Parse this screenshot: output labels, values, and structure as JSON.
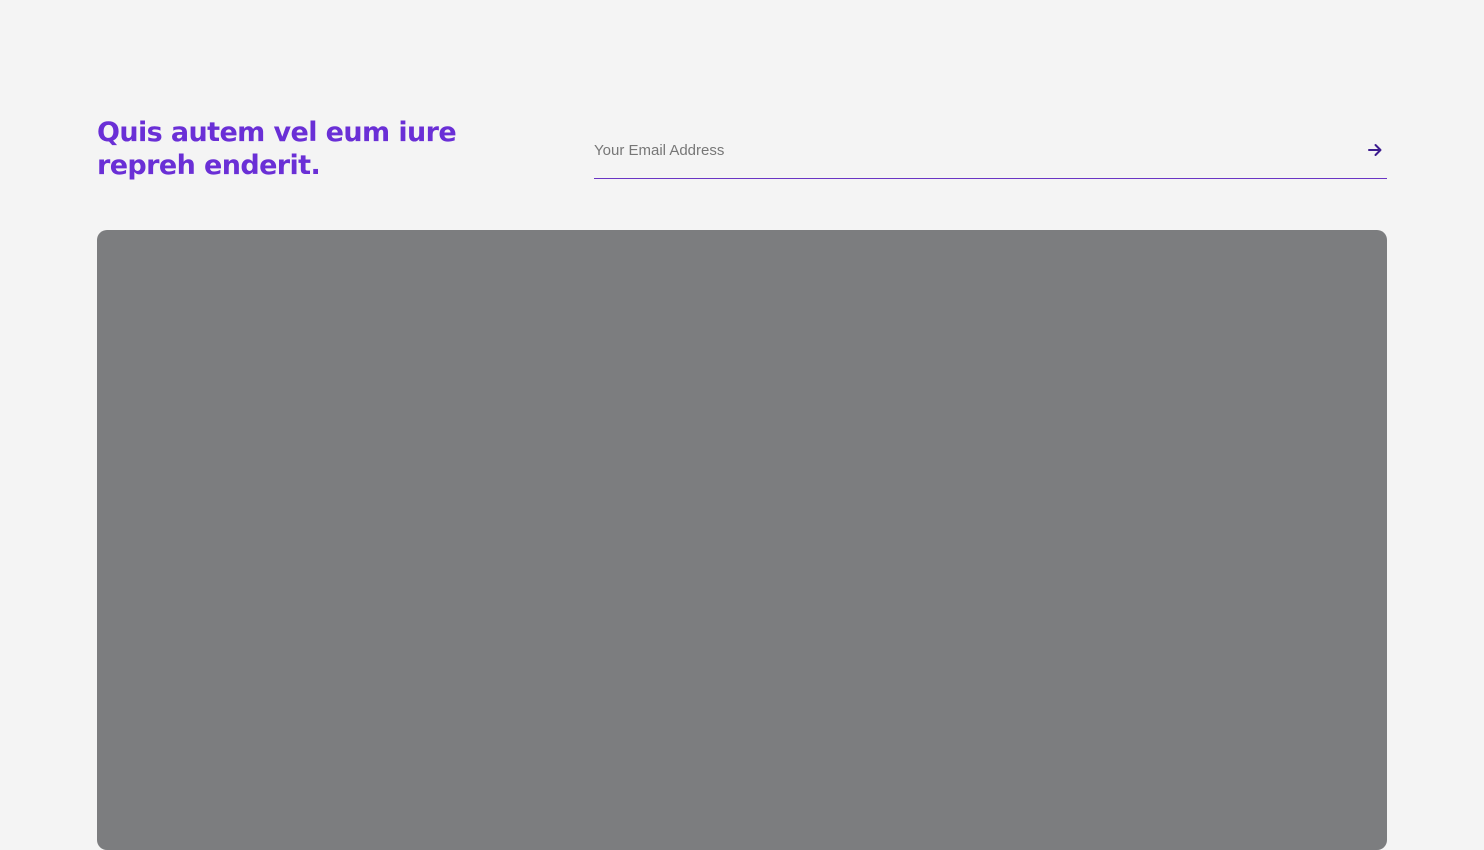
{
  "newsletter": {
    "headline": "Quis autem vel eum iure repreh enderit.",
    "email_placeholder": "Your Email Address",
    "submit_icon": "arrow-right-icon",
    "accent_color": "#6a2fd6"
  },
  "media": {
    "background_color": "#7c7d7f"
  }
}
